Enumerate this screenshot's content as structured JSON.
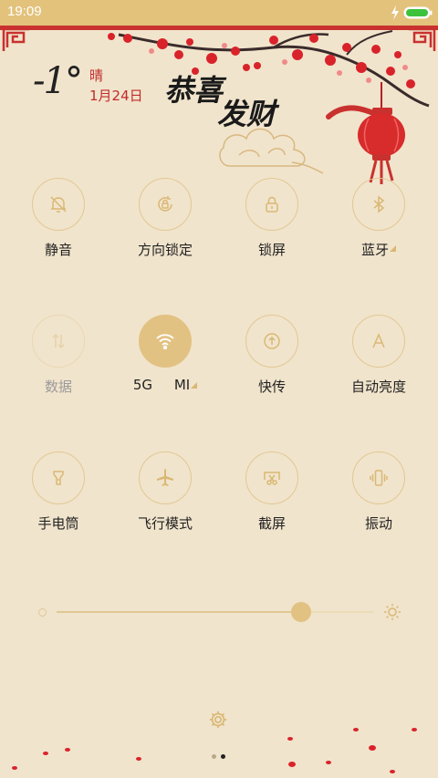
{
  "status": {
    "time": "19:09"
  },
  "header": {
    "temperature": "-1°",
    "weather": "晴",
    "date": "1月24日",
    "greeting_line1": "恭喜",
    "greeting_line2": "发财"
  },
  "toggles": [
    {
      "label": "静音",
      "icon": "bell-off-icon",
      "state": "off"
    },
    {
      "label": "方向锁定",
      "icon": "rotation-lock-icon",
      "state": "off"
    },
    {
      "label": "锁屏",
      "icon": "lock-icon",
      "state": "off"
    },
    {
      "label": "蓝牙",
      "icon": "bluetooth-icon",
      "state": "off"
    },
    {
      "label": "数据",
      "icon": "data-arrows-icon",
      "state": "disabled"
    },
    {
      "label": "5G     MI",
      "icon": "wifi-icon",
      "state": "on"
    },
    {
      "label": "快传",
      "icon": "upload-icon",
      "state": "off"
    },
    {
      "label": "自动亮度",
      "icon": "auto-brightness-icon",
      "state": "off"
    },
    {
      "label": "手电筒",
      "icon": "flashlight-icon",
      "state": "off"
    },
    {
      "label": "飞行模式",
      "icon": "airplane-icon",
      "state": "off"
    },
    {
      "label": "截屏",
      "icon": "screenshot-icon",
      "state": "off"
    },
    {
      "label": "振动",
      "icon": "vibrate-icon",
      "state": "off"
    }
  ],
  "brightness": {
    "level": 0.77
  },
  "pager": {
    "pages": 2,
    "current": 2
  },
  "colors": {
    "background": "#f1e4cc",
    "accent": "#e2c282",
    "status_bar": "#e3c27c",
    "festive_red": "#c9312f"
  }
}
